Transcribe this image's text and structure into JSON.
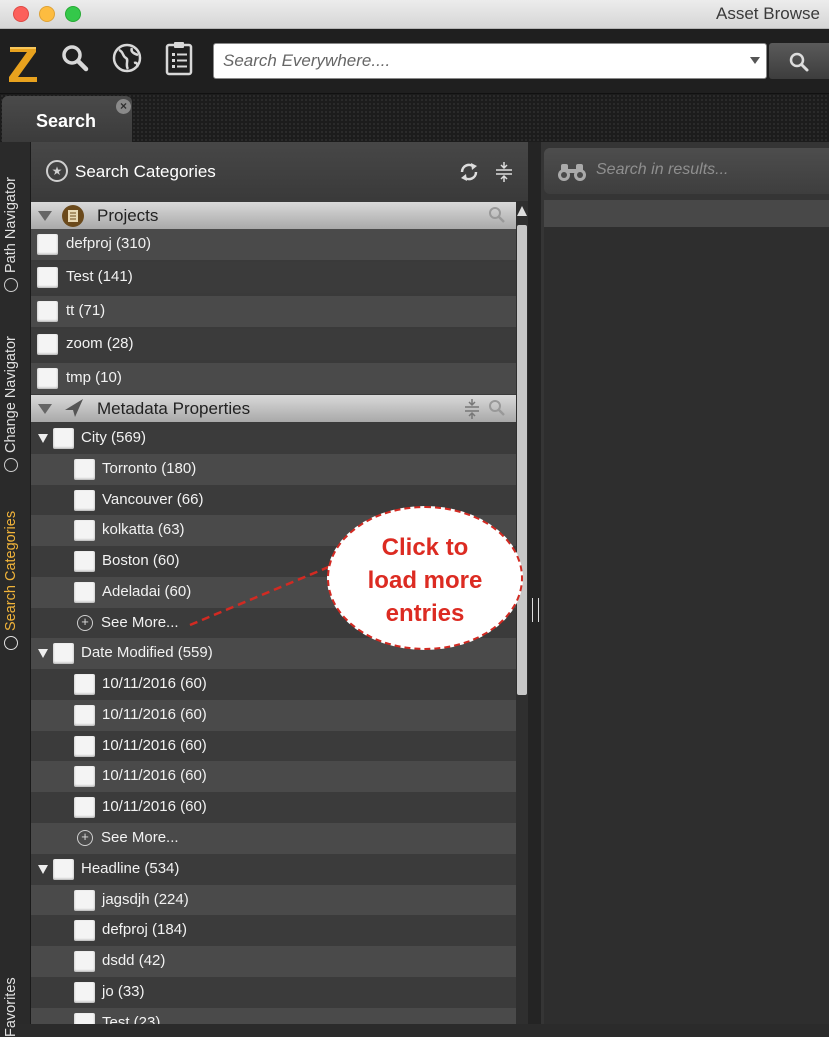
{
  "window": {
    "title": "Asset Browse"
  },
  "toolbar": {
    "search_placeholder": "Search Everywhere...."
  },
  "tab": {
    "label": "Search",
    "close": "×"
  },
  "left_tabs": [
    {
      "label": "Path Navigator",
      "icon": "path-navigator-icon"
    },
    {
      "label": "Change Navigator",
      "icon": "compass-icon"
    },
    {
      "label": "Search Categories",
      "icon": "star-icon",
      "active": true,
      "active_color": "#f0b33a"
    },
    {
      "label": "Favorites",
      "icon": "favorites-icon"
    }
  ],
  "panel": {
    "title": "Search Categories"
  },
  "projects": {
    "title": "Projects",
    "items": [
      "defproj (310)",
      "Test (141)",
      "tt (71)",
      "zoom (28)",
      "tmp (10)"
    ]
  },
  "metadata": {
    "title": "Metadata Properties",
    "city": {
      "label": "City (569)",
      "items": [
        "Torronto (180)",
        "Vancouver (66)",
        "kolkatta (63)",
        "Boston (60)",
        "Adeladai (60)"
      ],
      "see_more": "See More..."
    },
    "date_modified": {
      "label": "Date Modified (559)",
      "items": [
        "10/11/2016 (60)",
        "10/11/2016 (60)",
        "10/11/2016 (60)",
        "10/11/2016 (60)",
        "10/11/2016 (60)"
      ],
      "see_more": "See More..."
    },
    "headline": {
      "label": "Headline (534)",
      "items": [
        "jagsdjh (224)",
        "defproj (184)",
        "dsdd (42)",
        "jo (33)",
        "Test (23)"
      ]
    }
  },
  "results": {
    "search_placeholder": "Search in results..."
  },
  "callout": {
    "lines": [
      "Click to",
      "load more",
      "entries"
    ],
    "color": "#dc2b22"
  }
}
